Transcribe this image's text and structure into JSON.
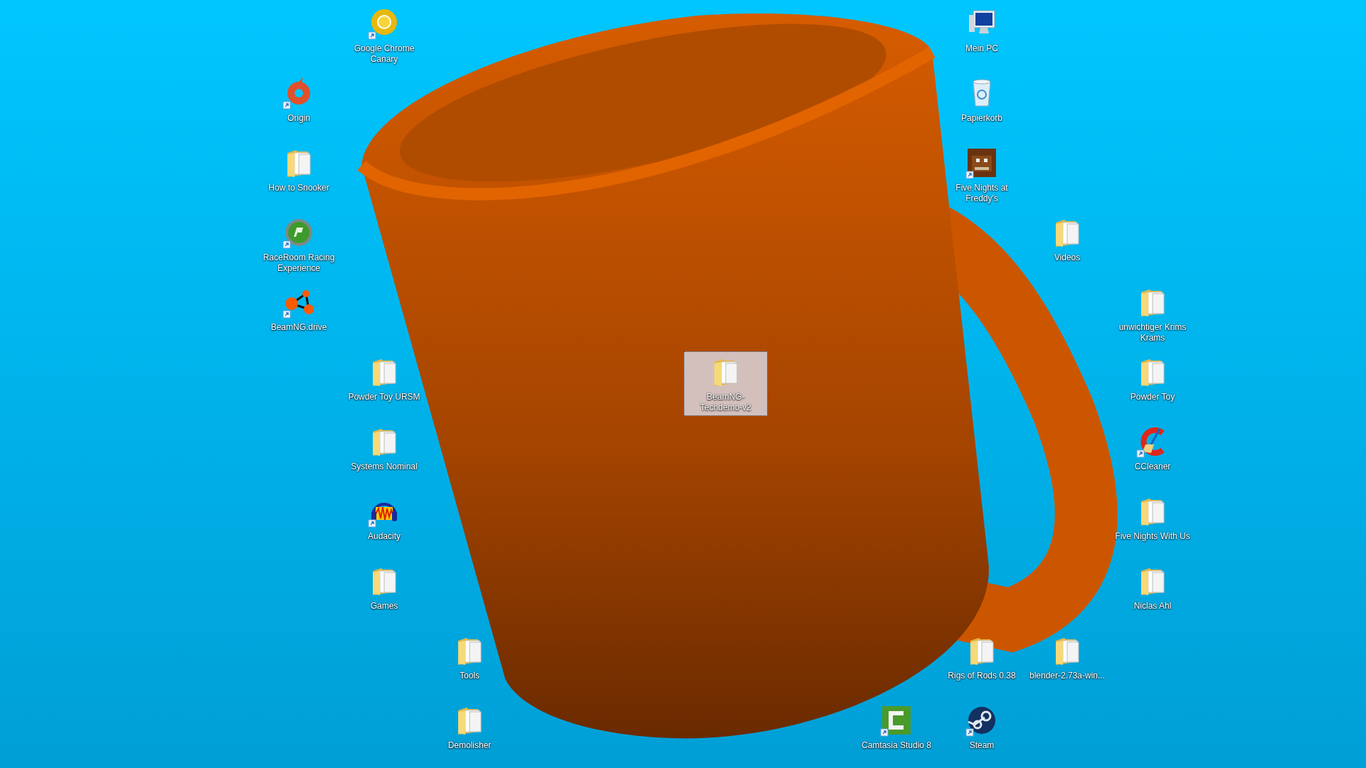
{
  "desktop": {
    "icons": [
      {
        "label": "Google Chrome Canary",
        "kind": "chrome",
        "shortcut": true,
        "selected": false
      },
      {
        "label": "Origin",
        "kind": "origin",
        "shortcut": true,
        "selected": false
      },
      {
        "label": "How to Snooker",
        "kind": "folder",
        "shortcut": false,
        "selected": false
      },
      {
        "label": "RaceRoom Racing Experience",
        "kind": "raceroom",
        "shortcut": true,
        "selected": false
      },
      {
        "label": "BeamNG.drive",
        "kind": "beamng",
        "shortcut": true,
        "selected": false
      },
      {
        "label": "Powder Toy URSM",
        "kind": "folder",
        "shortcut": false,
        "selected": false
      },
      {
        "label": "Systems Nominal",
        "kind": "folder",
        "shortcut": false,
        "selected": false
      },
      {
        "label": "Audacity",
        "kind": "audacity",
        "shortcut": true,
        "selected": false
      },
      {
        "label": "Games",
        "kind": "folder",
        "shortcut": false,
        "selected": false
      },
      {
        "label": "Tools",
        "kind": "folder",
        "shortcut": false,
        "selected": false
      },
      {
        "label": "Demolisher",
        "kind": "folder",
        "shortcut": false,
        "selected": false
      },
      {
        "label": "BeamNG-Techdemo-v2",
        "kind": "folder",
        "shortcut": false,
        "selected": true
      },
      {
        "label": "Mein PC",
        "kind": "computer",
        "shortcut": false,
        "selected": false
      },
      {
        "label": "Papierkorb",
        "kind": "recycle-bin",
        "shortcut": false,
        "selected": false
      },
      {
        "label": "Five Nights at Freddy's",
        "kind": "game-art",
        "shortcut": true,
        "selected": false
      },
      {
        "label": "Videos",
        "kind": "folder",
        "shortcut": false,
        "selected": false
      },
      {
        "label": "unwichtiger Krims Krams",
        "kind": "folder",
        "shortcut": false,
        "selected": false
      },
      {
        "label": "Powder Toy",
        "kind": "folder",
        "shortcut": false,
        "selected": false
      },
      {
        "label": "CCleaner",
        "kind": "ccleaner",
        "shortcut": true,
        "selected": false
      },
      {
        "label": "Five Nights With Us",
        "kind": "folder",
        "shortcut": false,
        "selected": false
      },
      {
        "label": "Niclas Ahl",
        "kind": "folder",
        "shortcut": false,
        "selected": false
      },
      {
        "label": "Rigs of Rods 0.38",
        "kind": "folder",
        "shortcut": false,
        "selected": false
      },
      {
        "label": "blender-2.73a-win...",
        "kind": "folder",
        "shortcut": false,
        "selected": false
      },
      {
        "label": "Camtasia Studio 8",
        "kind": "camtasia",
        "shortcut": true,
        "selected": false
      },
      {
        "label": "Steam",
        "kind": "steam",
        "shortcut": true,
        "selected": false
      }
    ]
  }
}
